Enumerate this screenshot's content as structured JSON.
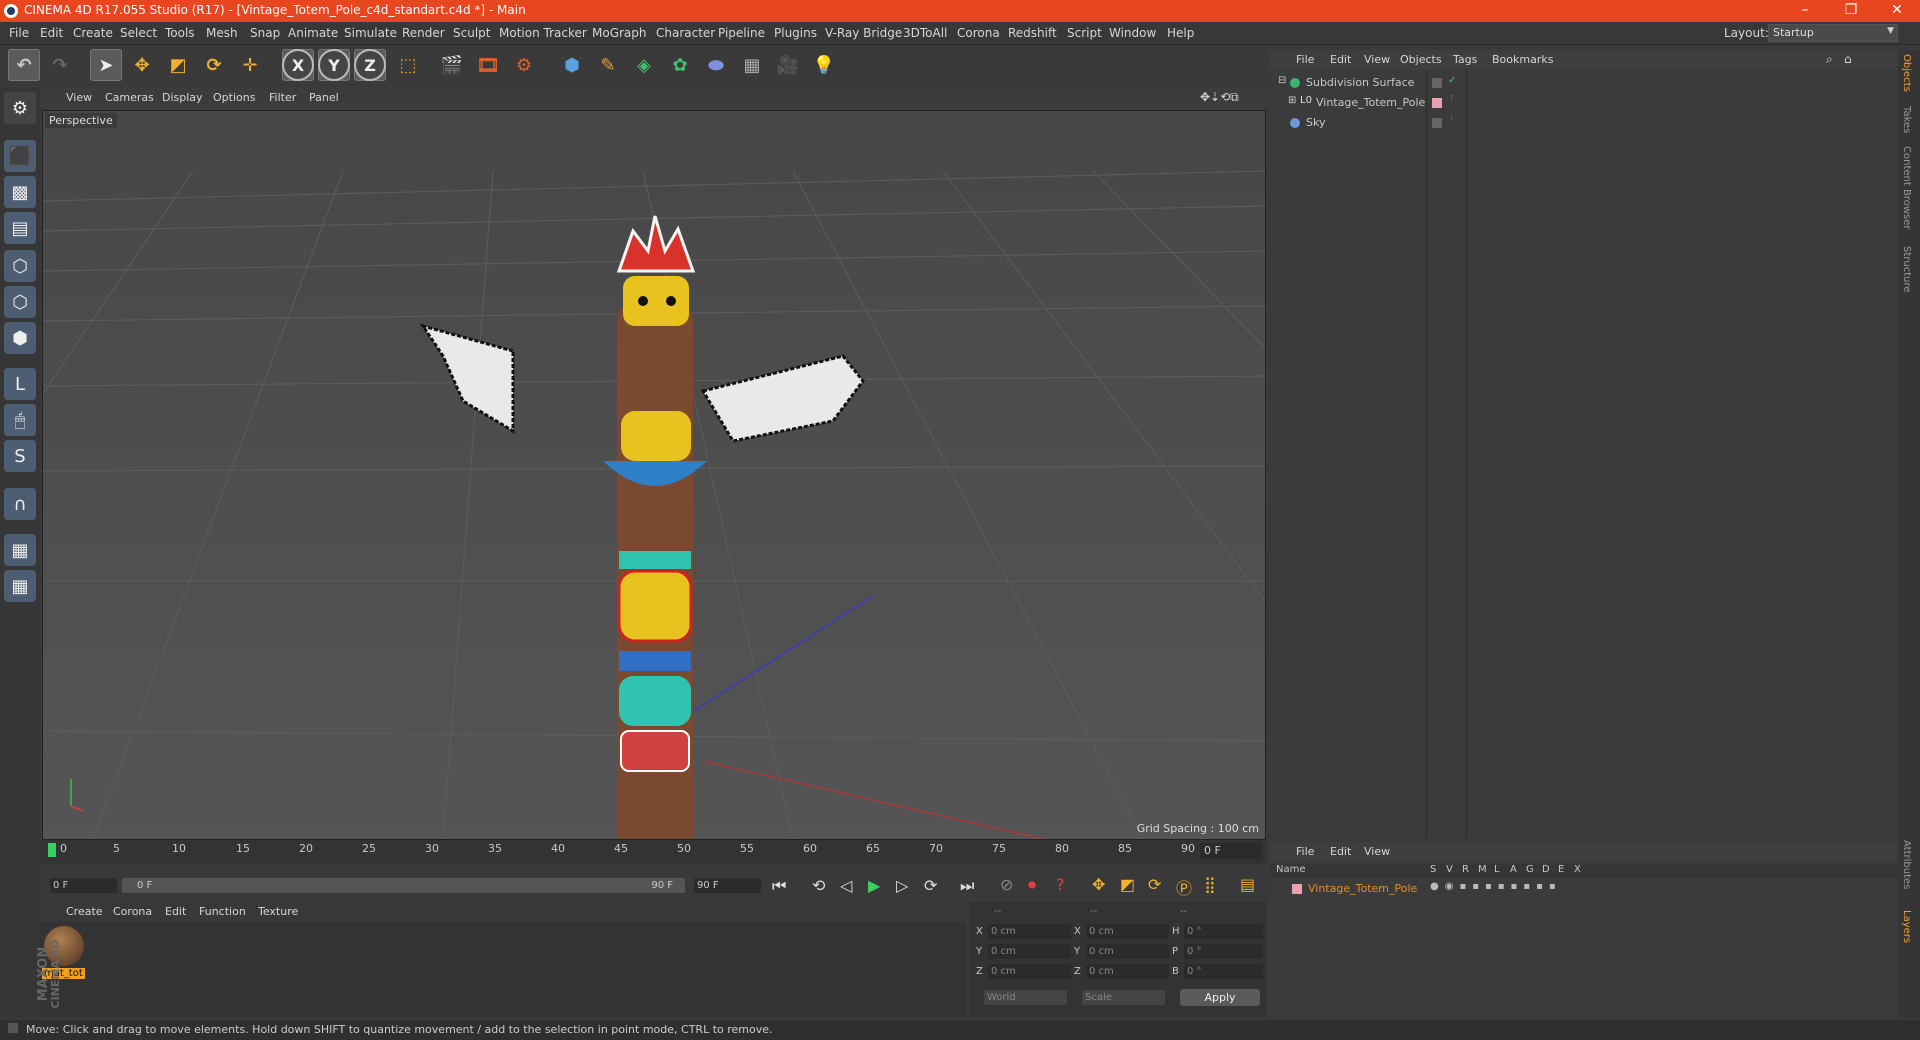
{
  "window": {
    "title": "CINEMA 4D R17.055 Studio (R17) - [Vintage_Totem_Pole_c4d_standart.c4d *] - Main",
    "controls": [
      "–",
      "❐",
      "✕"
    ]
  },
  "menubar": {
    "items": [
      "File",
      "Edit",
      "Create",
      "Select",
      "Tools",
      "Mesh",
      "Snap",
      "Animate",
      "Simulate",
      "Render",
      "Sculpt",
      "Motion Tracker",
      "MoGraph",
      "Character",
      "Pipeline",
      "Plugins",
      "V-Ray Bridge",
      "3DToAll",
      "Corona",
      "Redshift",
      "Script",
      "Window",
      "Help"
    ],
    "layout_label": "Layout:",
    "layout_value": "Startup"
  },
  "toolbar": {
    "undo_icon": "undo-icon",
    "axes": [
      "X",
      "Y",
      "Z"
    ]
  },
  "viewport": {
    "menu": [
      "View",
      "Cameras",
      "Display",
      "Options",
      "Filter",
      "Panel"
    ],
    "label": "Perspective",
    "grid_spacing": "Grid Spacing : 100 cm",
    "colors": {
      "bg": "#4b4b4b",
      "grid": "#5a5a5a"
    }
  },
  "timeline": {
    "ticks": [
      "0",
      "5",
      "10",
      "15",
      "20",
      "25",
      "30",
      "35",
      "40",
      "45",
      "50",
      "55",
      "60",
      "65",
      "70",
      "75",
      "80",
      "85",
      "90"
    ],
    "current_frame": "0 F",
    "start_field": "0 F",
    "range_start": "0 F",
    "range_end": "90 F",
    "end_field": "90 F"
  },
  "material_manager": {
    "menu": [
      "Create",
      "Corona",
      "Edit",
      "Function",
      "Texture"
    ],
    "materials": [
      {
        "name": "mat_tot"
      }
    ]
  },
  "coordinates": {
    "headers": [
      "--",
      "--",
      "--"
    ],
    "rows": [
      {
        "a": "X",
        "av": "0 cm",
        "b": "X",
        "bv": "0 cm",
        "c": "H",
        "cv": "0 °"
      },
      {
        "a": "Y",
        "av": "0 cm",
        "b": "Y",
        "bv": "0 cm",
        "c": "P",
        "cv": "0 °"
      },
      {
        "a": "Z",
        "av": "0 cm",
        "b": "Z",
        "bv": "0 cm",
        "c": "B",
        "cv": "0 °"
      }
    ],
    "mode1": "World",
    "mode2": "Scale",
    "apply": "Apply"
  },
  "object_manager": {
    "menu": [
      "File",
      "Edit",
      "View",
      "Objects",
      "Tags",
      "Bookmarks"
    ],
    "objects": [
      {
        "name": "Subdivision Surface",
        "color": "#3cb371"
      },
      {
        "name": "Vintage_Totem_Pole",
        "color": "#cccccc"
      },
      {
        "name": "Sky",
        "color": "#6a9bd8"
      }
    ]
  },
  "layer_manager": {
    "menu": [
      "File",
      "Edit",
      "View"
    ],
    "columns": [
      "Name",
      "S",
      "V",
      "R",
      "M",
      "L",
      "A",
      "G",
      "D",
      "E",
      "X"
    ],
    "layers": [
      {
        "name": "Vintage_Totem_Pole",
        "color": "#e38f2a"
      }
    ]
  },
  "right_tabs": [
    "Objects",
    "Takes",
    "Content Browser",
    "Structure",
    "Attributes",
    "Layers"
  ],
  "branding": {
    "line1": "MAXON",
    "line2": "CINEMA 4D"
  },
  "status": {
    "text": "Move: Click and drag to move elements. Hold down SHIFT to quantize movement / add to the selection in point mode, CTRL to remove."
  }
}
